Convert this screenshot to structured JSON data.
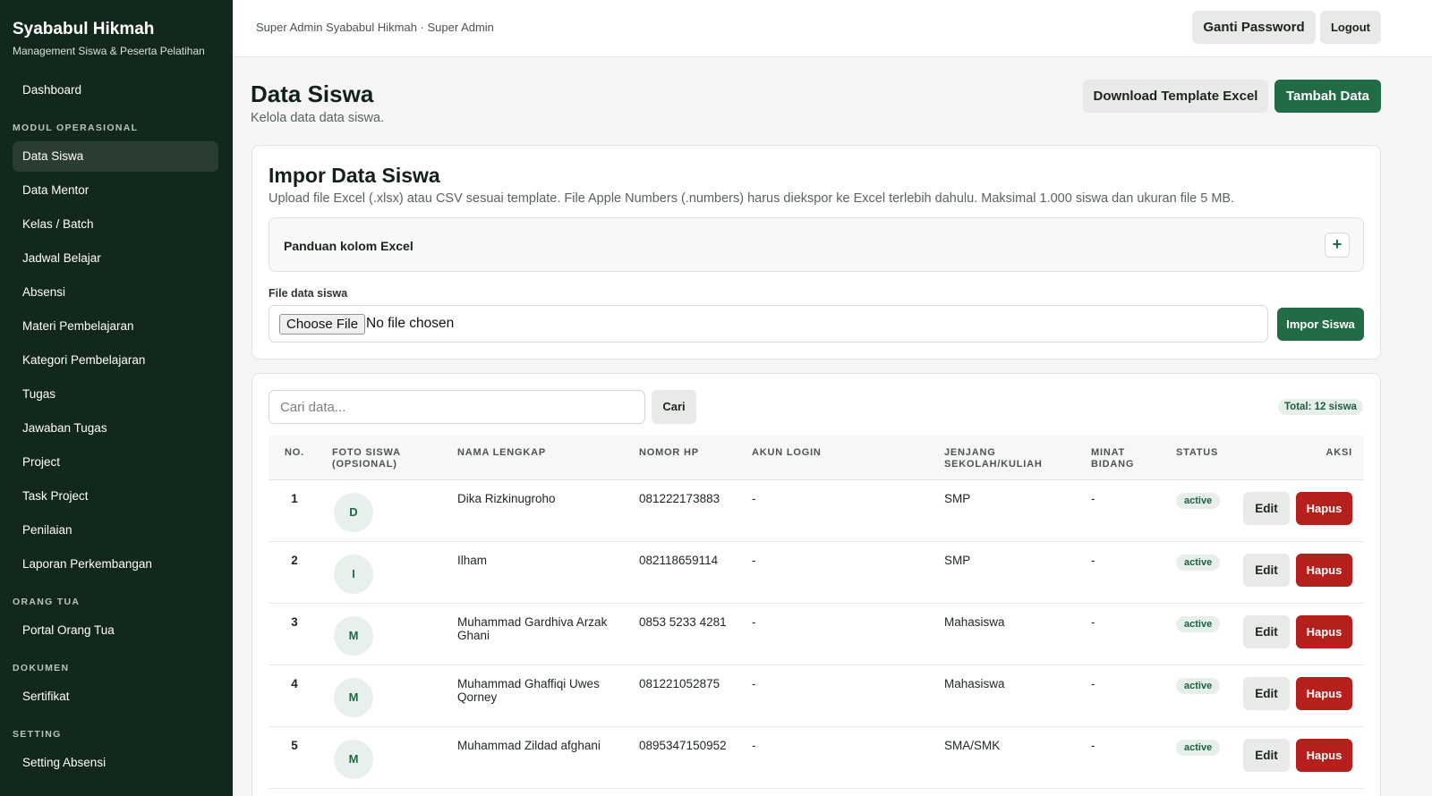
{
  "sidebar": {
    "brand_title": "Syababul Hikmah",
    "brand_subtitle": "Management Siswa & Peserta Pelatihan",
    "dashboard": "Dashboard",
    "sections": [
      {
        "title": "MODUL OPERASIONAL",
        "items": [
          "Data Siswa",
          "Data Mentor",
          "Kelas / Batch",
          "Jadwal Belajar",
          "Absensi",
          "Materi Pembelajaran",
          "Kategori Pembelajaran",
          "Tugas",
          "Jawaban Tugas",
          "Project",
          "Task Project",
          "Penilaian",
          "Laporan Perkembangan"
        ]
      },
      {
        "title": "ORANG TUA",
        "items": [
          "Portal Orang Tua"
        ]
      },
      {
        "title": "DOKUMEN",
        "items": [
          "Sertifikat"
        ]
      },
      {
        "title": "SETTING",
        "items": [
          "Setting Absensi"
        ]
      }
    ],
    "active_item": "Data Siswa"
  },
  "topbar": {
    "user_text": "Super Admin Syababul Hikmah · Super Admin",
    "change_password": "Ganti Password",
    "logout": "Logout"
  },
  "header": {
    "title": "Data Siswa",
    "subtitle": "Kelola data data siswa.",
    "download_template": "Download Template Excel",
    "add_data": "Tambah Data"
  },
  "import": {
    "title": "Impor Data Siswa",
    "description": "Upload file Excel (.xlsx) atau CSV sesuai template. File Apple Numbers (.numbers) harus diekspor ke Excel terlebih dahulu. Maksimal 1.000 siswa dan ukuran file 5 MB.",
    "guide_label": "Panduan kolom Excel",
    "guide_toggle": "+",
    "file_label": "File data siswa",
    "choose_file": "Choose File",
    "no_file": "No file chosen",
    "submit": "Impor Siswa"
  },
  "table": {
    "search_placeholder": "Cari data...",
    "search_button": "Cari",
    "total": "Total: 12 siswa",
    "columns": {
      "no": "NO.",
      "foto": "FOTO SISWA (OPSIONAL)",
      "nama": "NAMA LENGKAP",
      "hp": "NOMOR HP",
      "akun": "AKUN LOGIN",
      "jenjang": "JENJANG SEKOLAH/KULIAH",
      "minat": "MINAT BIDANG",
      "status": "STATUS",
      "aksi": "AKSI"
    },
    "edit_label": "Edit",
    "delete_label": "Hapus",
    "rows": [
      {
        "no": "1",
        "initial": "D",
        "nama": "Dika Rizkinugroho",
        "hp": "081222173883",
        "akun": "-",
        "jenjang": "SMP",
        "minat": "-",
        "status": "active"
      },
      {
        "no": "2",
        "initial": "I",
        "nama": "Ilham",
        "hp": "082118659114",
        "akun": "-",
        "jenjang": "SMP",
        "minat": "-",
        "status": "active"
      },
      {
        "no": "3",
        "initial": "M",
        "nama": "Muhammad Gardhiva Arzak Ghani",
        "hp": "0853 5233 4281",
        "akun": "-",
        "jenjang": "Mahasiswa",
        "minat": "-",
        "status": "active"
      },
      {
        "no": "4",
        "initial": "M",
        "nama": "Muhammad Ghaffiqi Uwes Qorney",
        "hp": "081221052875",
        "akun": "-",
        "jenjang": "Mahasiswa",
        "minat": "-",
        "status": "active"
      },
      {
        "no": "5",
        "initial": "M",
        "nama": "Muhammad Zildad afghani",
        "hp": "0895347150952",
        "akun": "-",
        "jenjang": "SMA/SMK",
        "minat": "-",
        "status": "active"
      }
    ]
  },
  "colors": {
    "sidebar_bg": "#13281d",
    "primary_green": "#216b45",
    "danger_red": "#b5201d"
  }
}
